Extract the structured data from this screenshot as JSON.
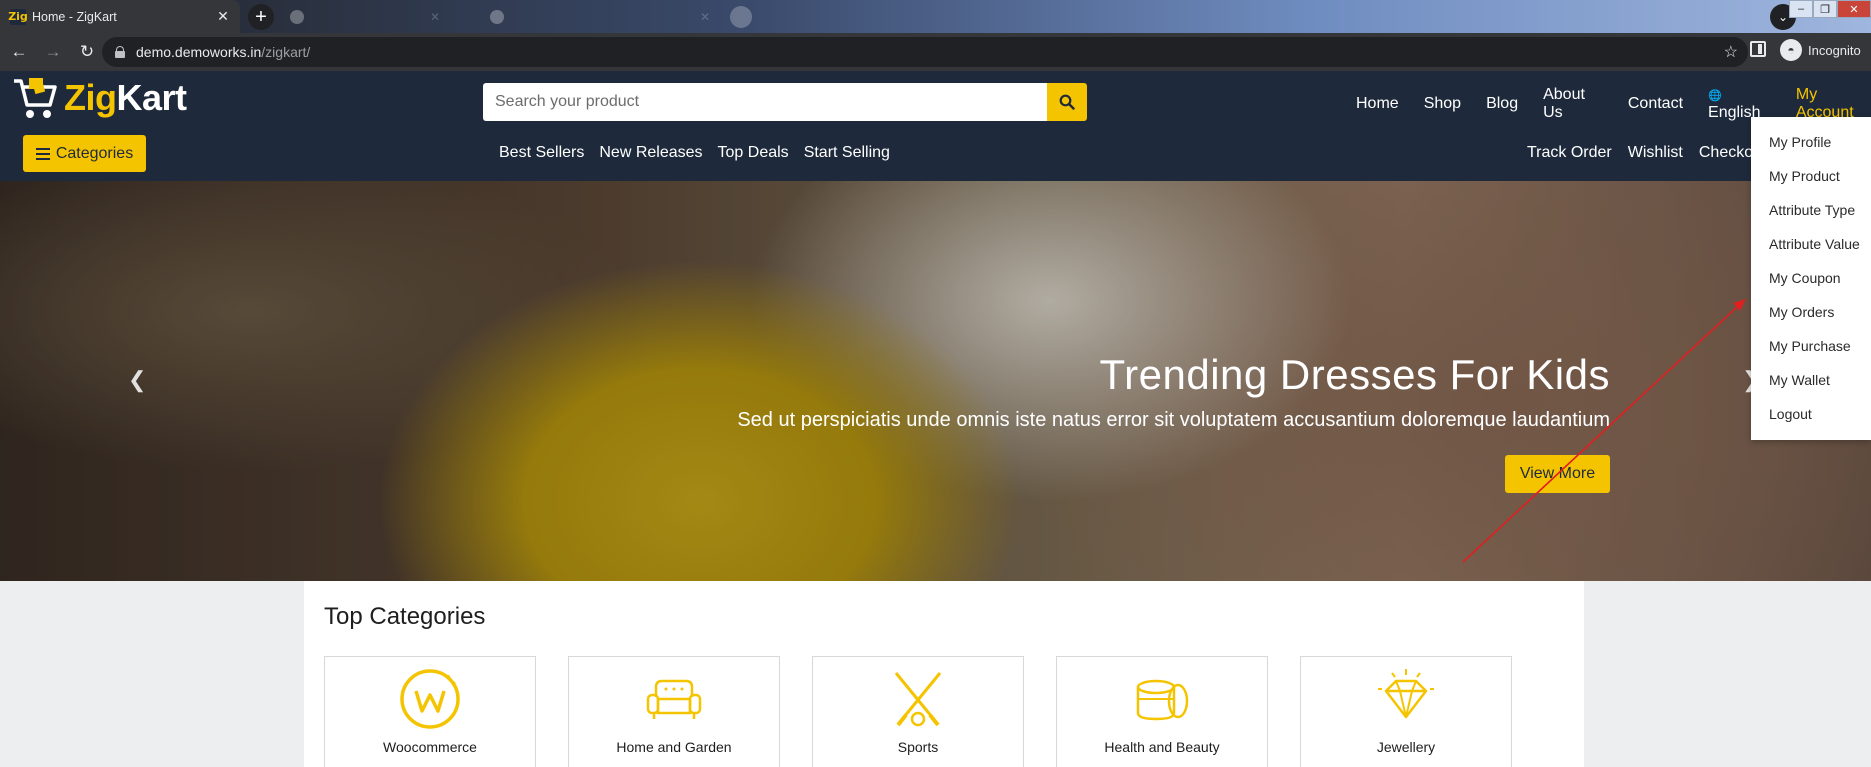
{
  "browser": {
    "tab_title": "Home - ZigKart",
    "tab_favicon": "Zig",
    "url_host": "demo.demoworks.in",
    "url_path": "/zigkart/",
    "profile_label": "Incognito"
  },
  "site": {
    "logo_prefix": "Zig",
    "logo_suffix": "Kart",
    "search_placeholder": "Search your product",
    "top_nav": [
      "Home",
      "Shop",
      "Blog",
      "About Us",
      "Contact"
    ],
    "language": "English",
    "account": "My Account",
    "categories_button": "Categories",
    "sub_nav": [
      "Best Sellers",
      "New Releases",
      "Top Deals",
      "Start Selling"
    ],
    "right_nav": [
      "Track Order",
      "Wishlist",
      "Checkout"
    ]
  },
  "hero": {
    "title": "Trending Dresses For Kids",
    "subtitle": "Sed ut perspiciatis unde omnis iste natus error sit voluptatem accusantium doloremque laudantium",
    "button": "View More"
  },
  "account_menu": [
    "My Profile",
    "My Product",
    "Attribute Type",
    "Attribute Value",
    "My Coupon",
    "My Orders",
    "My Purchase",
    "My Wallet",
    "Logout"
  ],
  "top_categories": {
    "title": "Top Categories",
    "items": [
      "Woocommerce",
      "Home and Garden",
      "Sports",
      "Health and Beauty",
      "Jewellery"
    ]
  },
  "colors": {
    "brand_yellow": "#f5c400",
    "header_navy": "#1e2a3b",
    "annotation_red": "#e02020"
  }
}
